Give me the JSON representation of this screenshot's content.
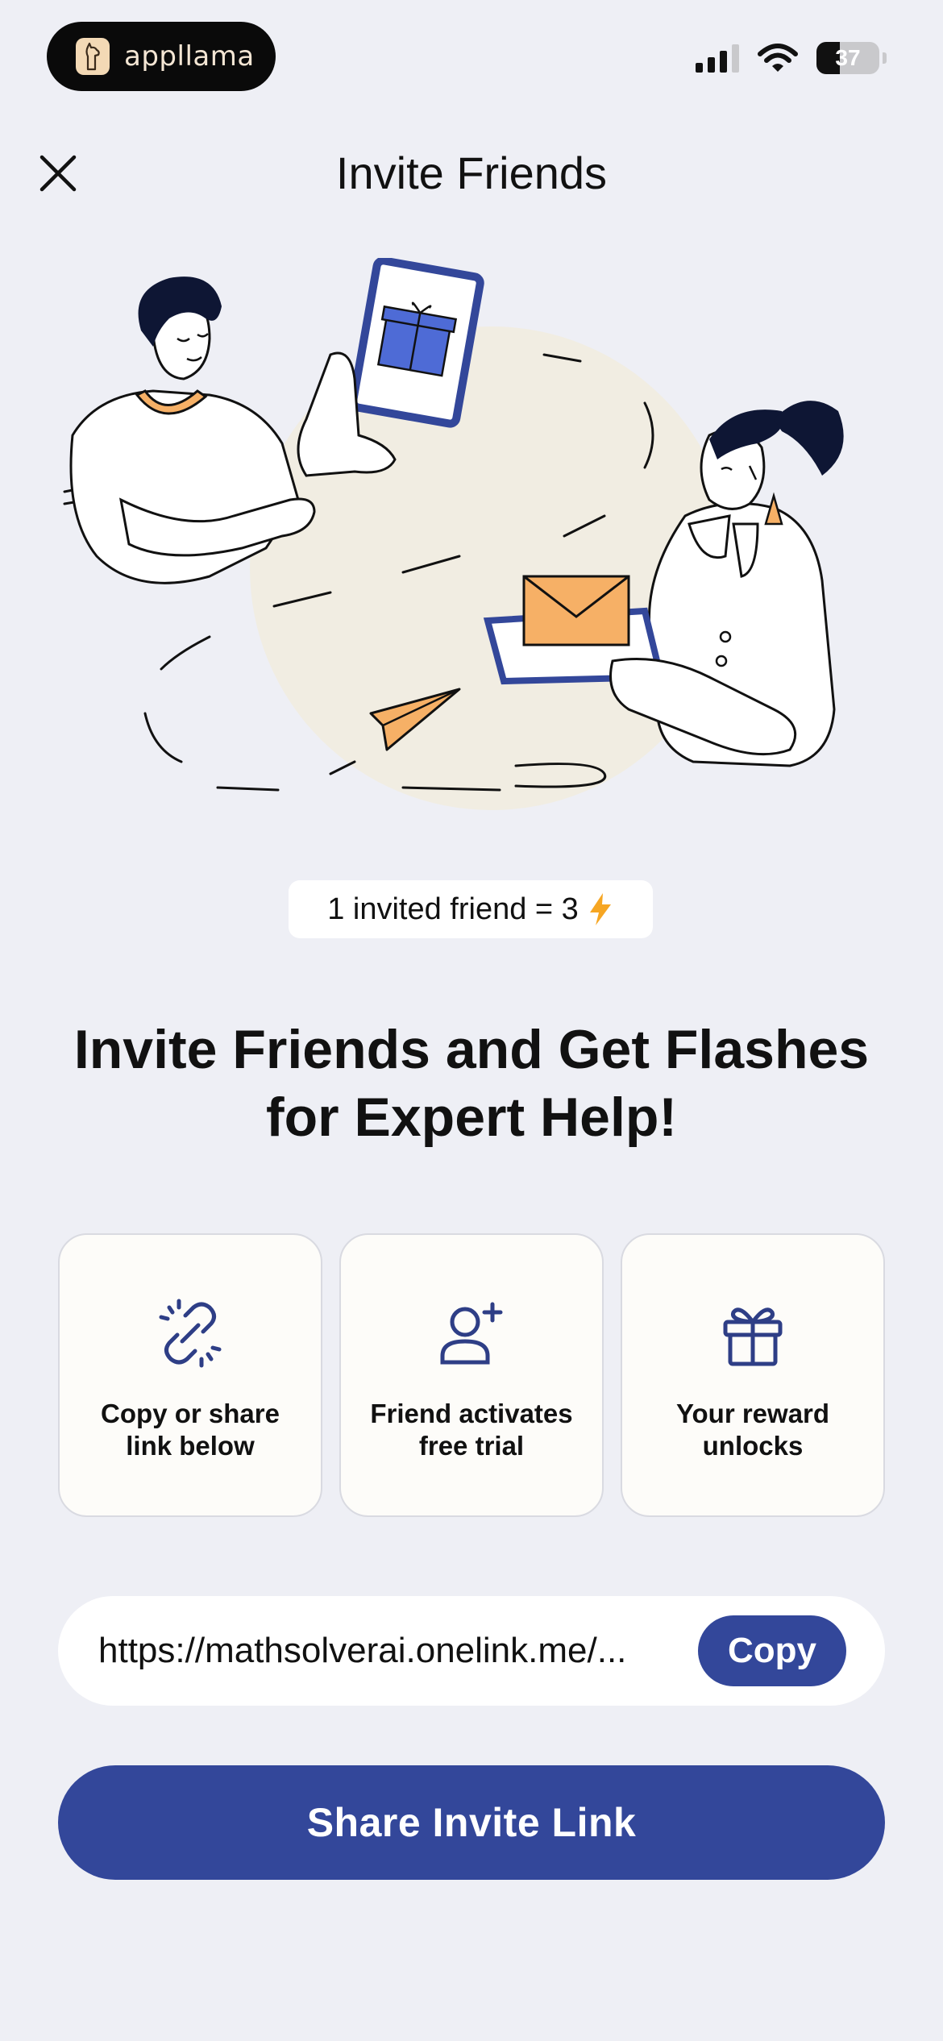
{
  "status_bar": {
    "brand": "appllama",
    "battery": "37",
    "battery_level_percent": 37,
    "icons": [
      "llama-logo-icon",
      "cellular-signal-icon",
      "wifi-icon",
      "battery-icon"
    ]
  },
  "header": {
    "title": "Invite Friends",
    "close_icon": "close-icon"
  },
  "reward_badge": {
    "text": "1 invited friend = 3",
    "icon": "lightning-icon"
  },
  "headline": "Invite Friends and Get Flashes for Expert Help!",
  "steps": [
    {
      "icon": "link-icon",
      "label": "Copy or share link below"
    },
    {
      "icon": "add-user-icon",
      "label": "Friend activates free trial"
    },
    {
      "icon": "gift-icon",
      "label": "Your reward unlocks"
    }
  ],
  "invite_link": {
    "url": "https://mathsolverai.onelink.me/...",
    "copy_label": "Copy"
  },
  "share_button_label": "Share Invite Link",
  "colors": {
    "background": "#EEEFF5",
    "primary": "#33479A",
    "accent_orange": "#F6B066",
    "illustration_circle": "#F1EDE2",
    "card_background": "#FDFCF9",
    "lightning": "#F6A623"
  }
}
